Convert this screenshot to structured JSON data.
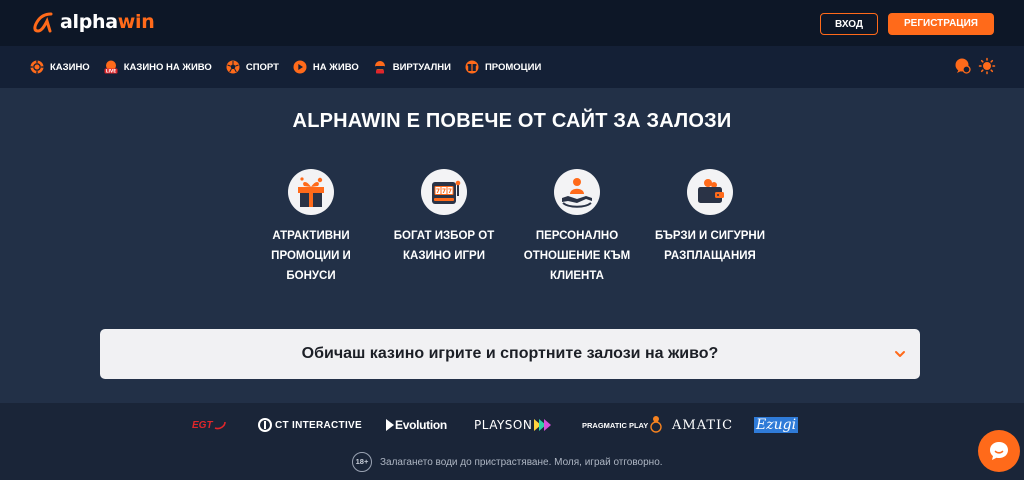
{
  "header": {
    "logo_alpha": "alpha",
    "logo_win": "win",
    "login_label": "ВХОД",
    "register_label": "РЕГИСТРАЦИЯ"
  },
  "nav": {
    "items": [
      {
        "label": "КАЗИНО",
        "icon": "casino-chip-icon"
      },
      {
        "label": "КАЗИНО НА ЖИВО",
        "icon": "live-casino-icon",
        "badge": "LIVE"
      },
      {
        "label": "СПОРТ",
        "icon": "football-icon"
      },
      {
        "label": "НА ЖИВО",
        "icon": "play-icon"
      },
      {
        "label": "ВИРТУАЛНИ",
        "icon": "virtual-icon"
      },
      {
        "label": "ПРОМОЦИИ",
        "icon": "promotions-icon"
      }
    ],
    "right_icons": [
      "chat-support-icon",
      "theme-sun-icon"
    ]
  },
  "hero": {
    "title": "ALPHAWIN Е ПОВЕЧЕ ОТ САЙТ ЗА ЗАЛОЗИ"
  },
  "features": [
    {
      "line1": "АТРАКТИВНИ",
      "line2": "ПРОМОЦИИ И",
      "line3": "БОНУСИ",
      "icon": "gift-icon"
    },
    {
      "line1": "БОГАТ ИЗБОР ОТ",
      "line2": "КАЗИНО ИГРИ",
      "line3": "",
      "icon": "slot-machine-icon"
    },
    {
      "line1": "ПЕРСОНАЛНО",
      "line2": "ОТНОШЕНИЕ КЪМ",
      "line3": "КЛИЕНТА",
      "icon": "customer-care-icon"
    },
    {
      "line1": "БЪРЗИ И СИГУРНИ",
      "line2": "РАЗПЛАЩАНИЯ",
      "line3": "",
      "icon": "wallet-icon"
    }
  ],
  "faq": {
    "question": "Обичаш казино игрите и спортните залози на живо?"
  },
  "providers": [
    "EGT",
    "CT INTERACTIVE",
    "Evolution",
    "PLAYSON",
    "PRAGMATIC PLAY",
    "AMATIC",
    "Ezugi"
  ],
  "footer": {
    "age": "18+",
    "warning": "Залагането води до пристрастяване. Моля, играй отговорно."
  },
  "colors": {
    "accent": "#ff6a1a",
    "header_bg": "#0d1727",
    "nav_bg": "#142036",
    "body_bg": "#223047"
  }
}
